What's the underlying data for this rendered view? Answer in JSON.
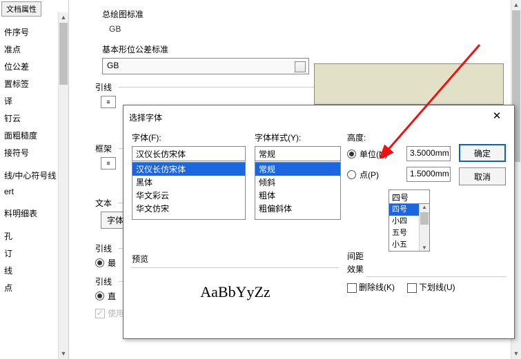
{
  "sidebar": {
    "tab": "文档属性",
    "items": [
      "",
      "件序号",
      "准点",
      "位公差",
      "置标签",
      "译",
      "钉云",
      "面粗糙度",
      "接符号",
      "",
      "线/中心符号线",
      "ert",
      "",
      "料明细表",
      "",
      "孔",
      "订",
      "线",
      "点"
    ]
  },
  "main": {
    "std_label": "总绘图标准",
    "std_value": "GB",
    "tol_label": "基本形位公差标准",
    "tol_value": "GB",
    "grp_leader": "引线",
    "grp_frame": "框架",
    "grp_text": "文本",
    "grp_leader2": "引线",
    "grp_leader3": "引线",
    "radio_max": "最",
    "radio_straight": "直",
    "font_btn": "字体",
    "doc_leader_len": "使用文档引线长度"
  },
  "dialog": {
    "title": "选择字体",
    "close": "✕",
    "font_label": "字体(F):",
    "font_value": "汉仪长仿宋体",
    "font_list": [
      "汉仪长仿宋体",
      "黑体",
      "华文彩云",
      "华文仿宋"
    ],
    "style_label": "字体样式(Y):",
    "style_value": "常规",
    "style_list": [
      "常规",
      "倾斜",
      "粗体",
      "粗偏斜体"
    ],
    "height_label": "高度:",
    "unit_label": "单位(N)",
    "unit_value": "3.5000mm",
    "point_label": "点(P)",
    "point_value": "1.5000mm",
    "size_input": "四号",
    "size_list": [
      "四号",
      "小四",
      "五号",
      "小五"
    ],
    "spacing_label": "间距",
    "ok": "确定",
    "cancel": "取消",
    "preview_label": "预览",
    "preview_text": "AaBbYyZz",
    "fx_label": "效果",
    "strike_label": "删除线(K)",
    "underline_label": "下划线(U)"
  }
}
